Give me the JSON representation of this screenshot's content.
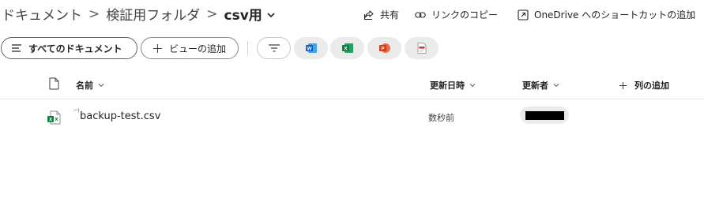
{
  "breadcrumb": {
    "items": [
      "ドキュメント",
      "検証用フォルダ"
    ],
    "separator": ">",
    "current": "csv用"
  },
  "commands": {
    "share": "共有",
    "copy_link": "リンクのコピー",
    "add_shortcut": "OneDrive へのショートカットの追加"
  },
  "views": {
    "all_documents": "すべてのドキュメント",
    "add_view": "ビューの追加"
  },
  "quick_filters": [
    {
      "icon": "word-icon",
      "color": "#185ABD"
    },
    {
      "icon": "excel-icon",
      "color": "#107C41"
    },
    {
      "icon": "powerpoint-icon",
      "color": "#C43E1C"
    },
    {
      "icon": "pdf-icon",
      "color": "#D13438"
    }
  ],
  "columns": {
    "name": "名前",
    "modified": "更新日時",
    "modified_by": "更新者",
    "add_column": "列の追加"
  },
  "files": [
    {
      "name": "backup-test.csv",
      "modified": "数秒前",
      "modified_by_redacted": true,
      "icon": "csv-file-icon"
    }
  ],
  "colors": {
    "text": "#242424",
    "border": "#8a8a8a",
    "chip_bg": "#ebebeb",
    "excel_green": "#107C41"
  }
}
